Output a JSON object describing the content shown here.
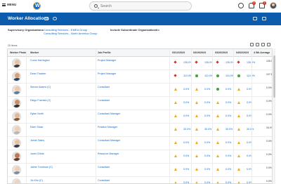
{
  "nav": {
    "menu_label": "MENU",
    "search_placeholder": "Search",
    "notifications_count": "9",
    "inbox_count": "1"
  },
  "header": {
    "title": "Worker Allocations"
  },
  "filters": {
    "supervisory_label": "Supervisory Organizations",
    "supervisory_values": [
      "Consulting Services - EMEA Group",
      "Consulting Services - North America Group"
    ],
    "subordinate_label": "Include Subordinate Organizations",
    "subordinate_value": "No"
  },
  "table": {
    "item_count": "25 items",
    "columns": [
      "Worker Photo",
      "Worker",
      "Job Profile",
      "03/12/2023",
      "03/19/2023",
      "03/26/2023",
      "04/02/2023",
      "4 Wk Average"
    ],
    "rows": [
      {
        "worker": "Conor Harrington",
        "job": "Project Manager",
        "values": [
          "135.0%",
          "135.0%",
          "135.0%",
          "135.0%"
        ],
        "markers": [
          "red",
          "red",
          "red",
          "red"
        ],
        "avg": "135.0%"
      },
      {
        "worker": "Dean Thacker",
        "job": "Project Manager",
        "values": [
          "110.0%",
          "110.0%",
          "110.0%",
          "110.0%"
        ],
        "markers": [
          "red",
          "green",
          "green",
          "green"
        ],
        "avg": "107.5%"
      },
      {
        "worker": "Steven Adams (C)",
        "job": "Consultant",
        "values": [
          "0.0%",
          "0.0%",
          "0.0%",
          "0.0%"
        ],
        "markers": [
          "amber",
          "amber",
          "green",
          "amber"
        ],
        "avg": "0.0%"
      },
      {
        "worker": "Diego Fuentes (C)",
        "job": "Consultant",
        "values": [
          "0.0%",
          "0.0%",
          "0.0%",
          "0.0%"
        ],
        "markers": [
          "amber",
          "amber",
          "amber",
          "amber"
        ],
        "avg": "0.0%"
      },
      {
        "worker": "Dylan North",
        "job": "Consultant Manager",
        "values": [
          "0.0%",
          "0.0%",
          "0.0%",
          "0.0%"
        ],
        "markers": [
          "amber",
          "amber",
          "amber",
          "amber"
        ],
        "avg": "0.0%"
      },
      {
        "worker": "Eden Shaw",
        "job": "Practice Manager",
        "values": [
          "30.0%",
          "30.0%",
          "30.0%",
          "30.0%"
        ],
        "markers": [
          "amber",
          "amber",
          "amber",
          "amber"
        ],
        "avg": "15.0%"
      },
      {
        "worker": "Jamie Gates",
        "job": "Consultant Manager",
        "values": [
          "0.0%",
          "0.0%",
          "0.0%",
          "0.0%"
        ],
        "markers": [
          "amber",
          "amber",
          "amber",
          "amber"
        ],
        "avg": "0.0%"
      },
      {
        "worker": "Janet Childs",
        "job": "Resource Manager",
        "values": [
          "0.0%",
          "0.0%",
          "0.0%",
          "0.0%"
        ],
        "markers": [
          "amber",
          "amber",
          "amber",
          "amber"
        ],
        "avg": "0.0%"
      },
      {
        "worker": "Jaime Troutman (C)",
        "job": "Consultant",
        "values": [
          "0.0%",
          "0.0%",
          "0.0%",
          "0.0%"
        ],
        "markers": [
          "amber",
          "amber",
          "amber",
          "amber"
        ],
        "avg": "0.0%"
      },
      {
        "worker": "Jin Kim (C)",
        "job": "Consultant",
        "values": [
          "0.0%",
          "0.0%",
          "0.0%",
          "0.0%"
        ],
        "markers": [
          "amber",
          "amber",
          "amber",
          "amber"
        ],
        "avg": "0.0%"
      }
    ]
  },
  "colors": {
    "brand_blue": "#0b5cad",
    "link": "#0b6bd2",
    "over": "#d0321d",
    "ok": "#3fa535",
    "under": "#f0a81c"
  }
}
